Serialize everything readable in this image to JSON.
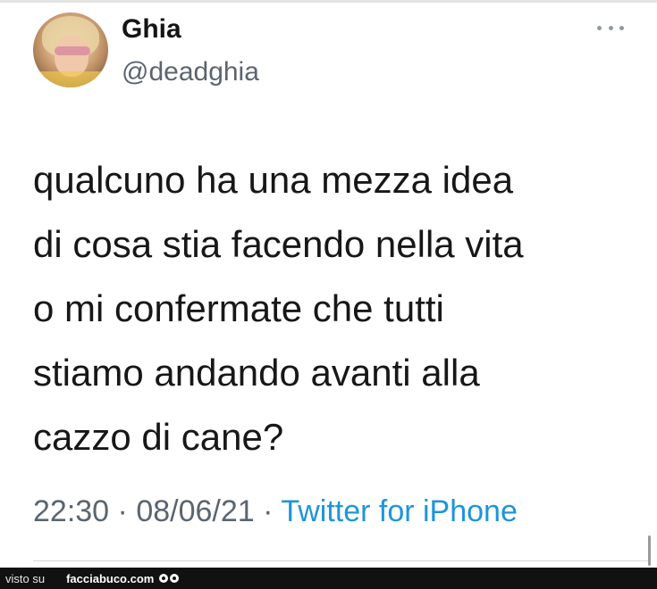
{
  "tweet": {
    "author": {
      "display_name": "Ghia",
      "handle": "@deadghia"
    },
    "text_lines": [
      "qualcuno ha una mezza idea",
      "di cosa stia facendo nella vita",
      "o mi confermate che tutti",
      "stiamo andando avanti alla",
      "cazzo di cane?"
    ],
    "meta": {
      "time": "22:30",
      "separator": "·",
      "date": "08/06/21",
      "source": "Twitter for iPhone"
    }
  },
  "footer": {
    "prefix": "visto su",
    "site": "facciabuco.com"
  },
  "colors": {
    "text": "#171717",
    "secondary": "#5b6570",
    "link": "#1d95db",
    "footer_bg": "#111111"
  },
  "icons": {
    "more": "more-horizontal-icon",
    "logo": "eyes-logo-icon"
  }
}
